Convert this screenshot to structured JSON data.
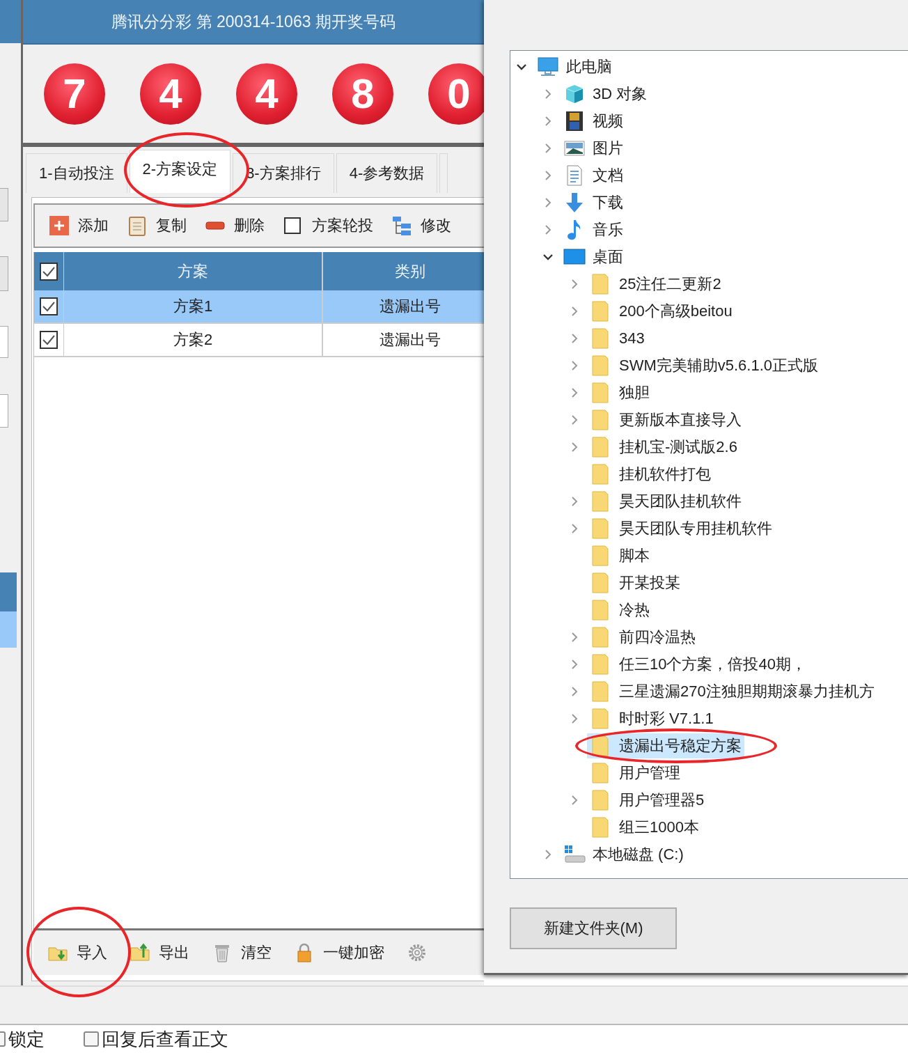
{
  "main_window": {
    "title": "腾讯分分彩 第 200314-1063 期开奖号码",
    "draw_numbers": [
      "7",
      "4",
      "4",
      "8",
      "0"
    ],
    "tabs": [
      {
        "label": "1-自动投注",
        "selected": false
      },
      {
        "label": "2-方案设定",
        "selected": true
      },
      {
        "label": "3-方案排行",
        "selected": false
      },
      {
        "label": "4-参考数据",
        "selected": false
      }
    ],
    "toolbar": [
      {
        "kind": "add",
        "label": "添加"
      },
      {
        "kind": "copy",
        "label": "复制"
      },
      {
        "kind": "delete",
        "label": "删除"
      },
      {
        "kind": "checkbox",
        "label": "方案轮投",
        "checked": false
      },
      {
        "kind": "edit",
        "label": "修改"
      }
    ],
    "table": {
      "all_checked": true,
      "columns": [
        "方案",
        "类别"
      ],
      "rows": [
        {
          "checked": true,
          "selected": true,
          "cells": [
            "方案1",
            "遗漏出号"
          ]
        },
        {
          "checked": true,
          "selected": false,
          "cells": [
            "方案2",
            "遗漏出号"
          ]
        }
      ]
    },
    "bottom_toolbar": [
      {
        "kind": "import",
        "label": "导入"
      },
      {
        "kind": "export",
        "label": "导出"
      },
      {
        "kind": "clear",
        "label": "清空"
      },
      {
        "kind": "lock",
        "label": "一键加密"
      },
      {
        "kind": "settings"
      }
    ]
  },
  "folder_dialog": {
    "tree": [
      {
        "kind": "computer",
        "label": "此电脑",
        "expandable": true,
        "expanded": true,
        "selected": false,
        "children": [
          {
            "kind": "cube",
            "label": "3D 对象",
            "expandable": true,
            "selected": false
          },
          {
            "kind": "video",
            "label": "视频",
            "expandable": true,
            "selected": false
          },
          {
            "kind": "picture",
            "label": "图片",
            "expandable": true,
            "selected": false
          },
          {
            "kind": "document",
            "label": "文档",
            "expandable": true,
            "selected": false
          },
          {
            "kind": "download",
            "label": "下载",
            "expandable": true,
            "selected": false
          },
          {
            "kind": "music",
            "label": "音乐",
            "expandable": true,
            "selected": false
          },
          {
            "kind": "desktop",
            "label": "桌面",
            "expandable": true,
            "expanded": true,
            "selected": false,
            "children": [
              {
                "kind": "folder",
                "label": "25注任二更新2",
                "expandable": true,
                "selected": false
              },
              {
                "kind": "folder",
                "label": "200个高级beitou",
                "expandable": true,
                "selected": false
              },
              {
                "kind": "folder",
                "label": "343",
                "expandable": true,
                "selected": false
              },
              {
                "kind": "folder",
                "label": "SWM完美辅助v5.6.1.0正式版",
                "expandable": true,
                "selected": false
              },
              {
                "kind": "folder",
                "label": "独胆",
                "expandable": true,
                "selected": false
              },
              {
                "kind": "folder",
                "label": "更新版本直接导入",
                "expandable": true,
                "selected": false
              },
              {
                "kind": "folder",
                "label": "挂机宝-测试版2.6",
                "expandable": true,
                "selected": false
              },
              {
                "kind": "folder",
                "label": "挂机软件打包",
                "expandable": false,
                "selected": false
              },
              {
                "kind": "folder",
                "label": "昊天团队挂机软件",
                "expandable": true,
                "selected": false
              },
              {
                "kind": "folder",
                "label": "昊天团队专用挂机软件",
                "expandable": true,
                "selected": false
              },
              {
                "kind": "folder",
                "label": "脚本",
                "expandable": false,
                "selected": false
              },
              {
                "kind": "folder",
                "label": "开某投某",
                "expandable": false,
                "selected": false
              },
              {
                "kind": "folder",
                "label": "冷热",
                "expandable": false,
                "selected": false
              },
              {
                "kind": "folder",
                "label": "前四冷温热",
                "expandable": true,
                "selected": false
              },
              {
                "kind": "folder",
                "label": "任三10个方案，倍投40期，",
                "expandable": true,
                "selected": false
              },
              {
                "kind": "folder",
                "label": "三星遗漏270注独胆期期滚暴力挂机方",
                "expandable": true,
                "selected": false
              },
              {
                "kind": "folder",
                "label": "时时彩 V7.1.1",
                "expandable": true,
                "selected": false
              },
              {
                "kind": "folder",
                "label": "遗漏出号稳定方案",
                "expandable": false,
                "selected": true
              },
              {
                "kind": "folder",
                "label": "用户管理",
                "expandable": false,
                "selected": false
              },
              {
                "kind": "folder",
                "label": "用户管理器5",
                "expandable": true,
                "selected": false
              },
              {
                "kind": "folder",
                "label": "组三1000本",
                "expandable": false,
                "selected": false
              }
            ]
          },
          {
            "kind": "drive",
            "label": "本地磁盘 (C:)",
            "expandable": true,
            "selected": false
          }
        ]
      }
    ],
    "new_folder_button": "新建文件夹(M)"
  },
  "footer": [
    {
      "label": "锁定",
      "checked": false
    },
    {
      "label": "回复后查看正文",
      "checked": false
    }
  ]
}
